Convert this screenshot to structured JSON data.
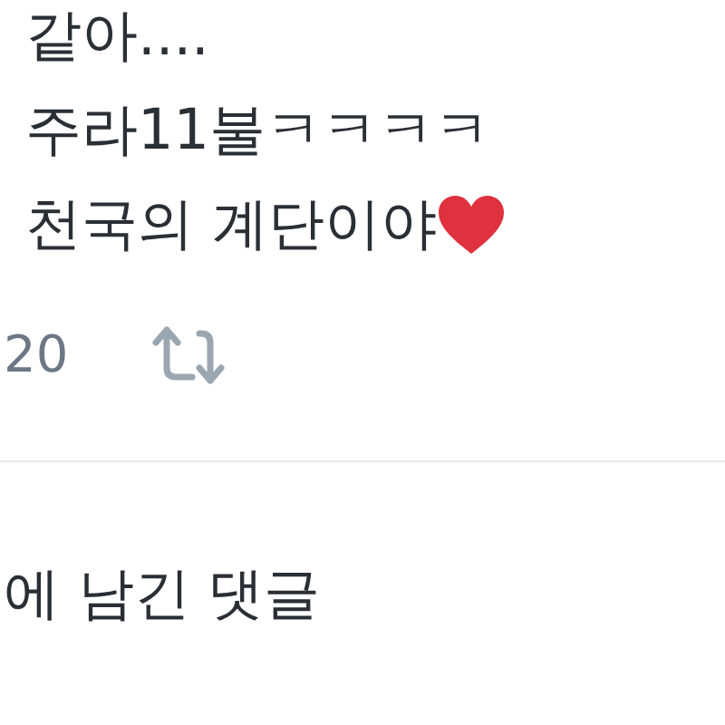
{
  "tweet": {
    "lines": [
      {
        "text": "같아....",
        "heart": false
      },
      {
        "text": "주라11불ㅋㅋㅋㅋ",
        "heart": false
      },
      {
        "text": "천국의 계단이야",
        "heart": true
      }
    ],
    "reply_count": "20"
  },
  "section_title": "에 남긴 댓글"
}
